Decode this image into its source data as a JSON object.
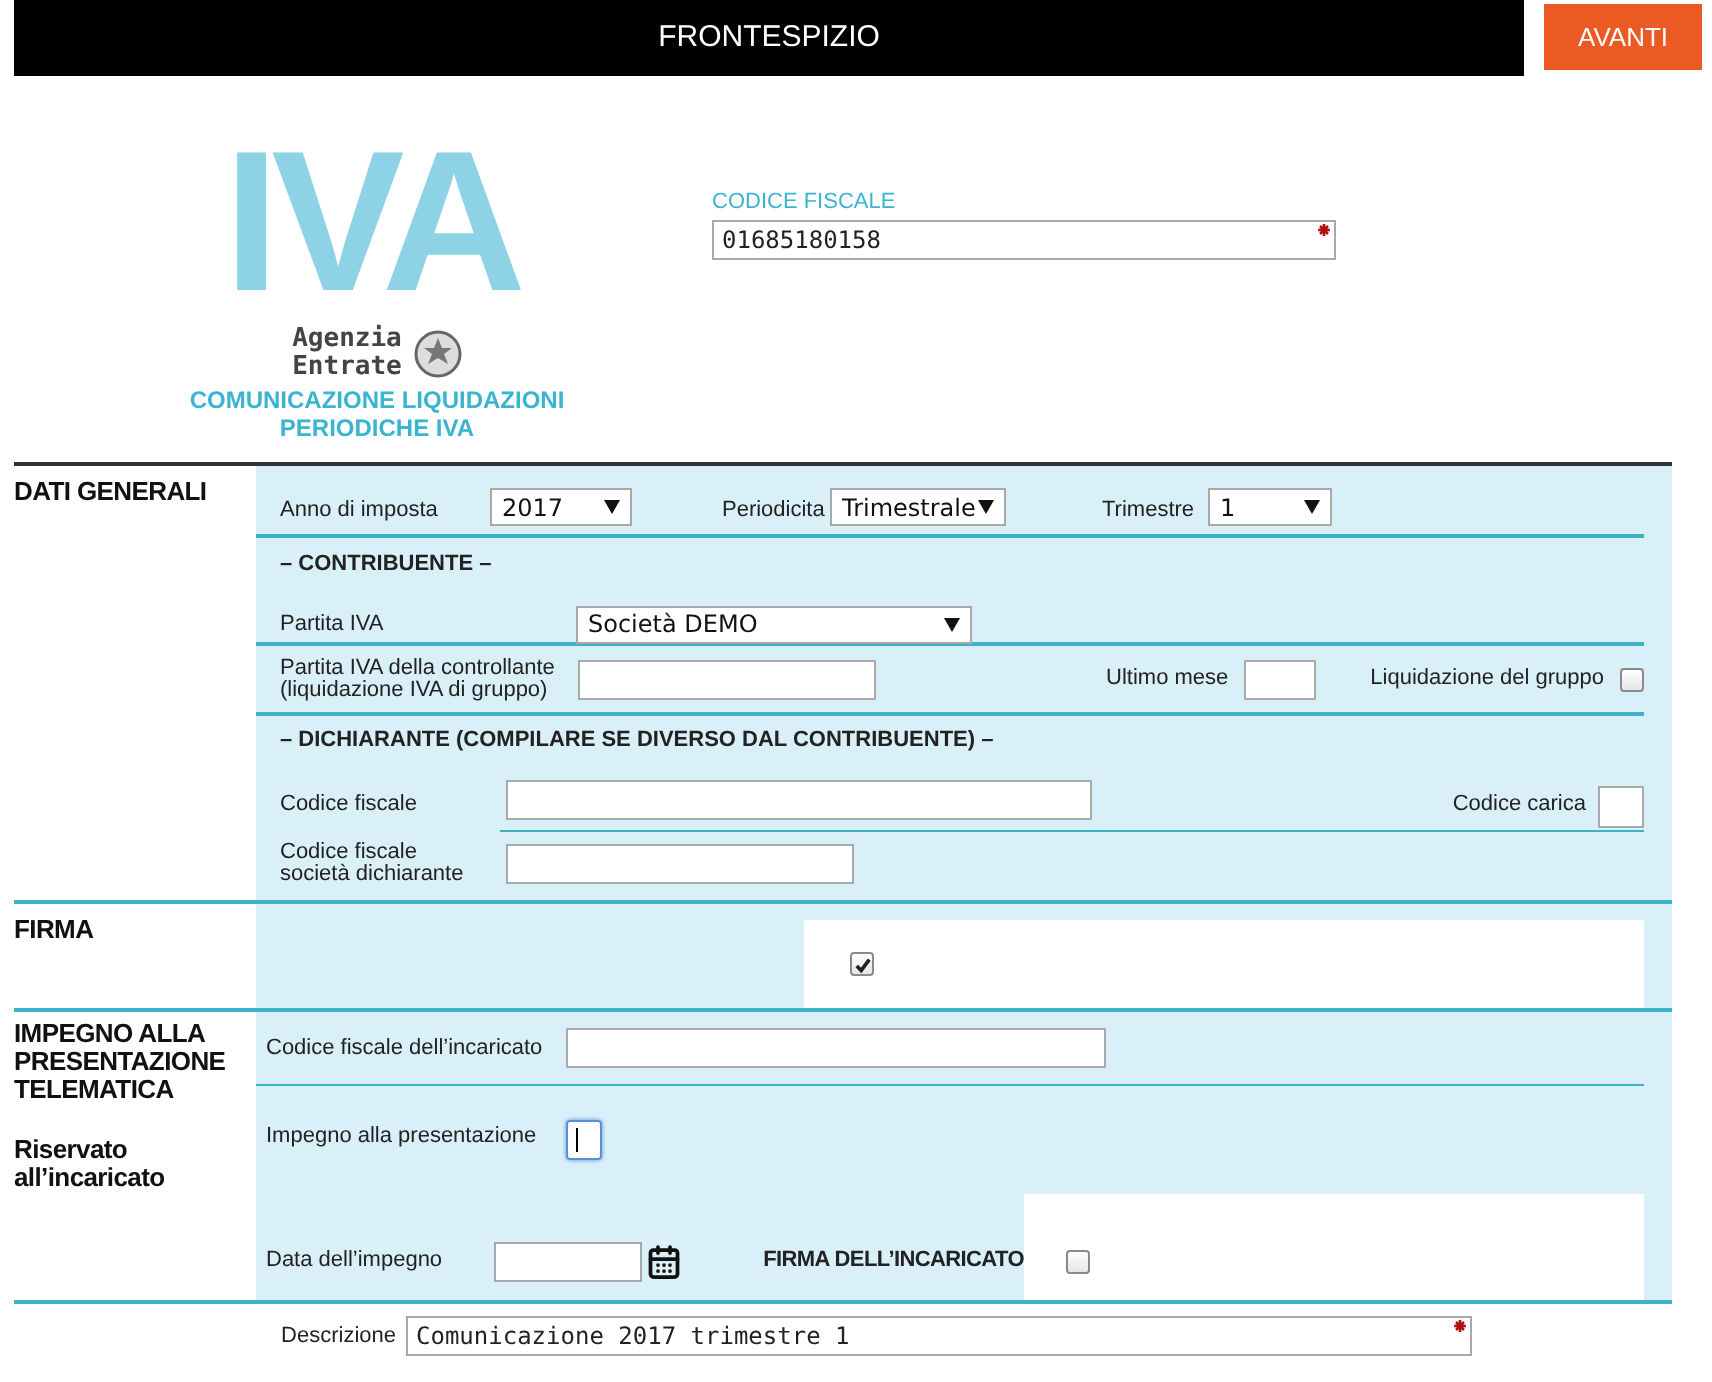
{
  "header": {
    "title": "FRONTESPIZIO",
    "next_button": "AVANTI"
  },
  "logo": {
    "mark": "IVA",
    "agency": [
      "Agenzia",
      "Entrate"
    ],
    "subtitle": [
      "COMUNICAZIONE LIQUIDAZIONI",
      "PERIODICHE IVA"
    ]
  },
  "codice_fiscale": {
    "label": "CODICE FISCALE",
    "value": "01685180158",
    "required": true
  },
  "dati_generali": {
    "title": "DATI GENERALI",
    "anno": {
      "label": "Anno di imposta",
      "value": "2017"
    },
    "periodicita": {
      "label": "Periodicita",
      "value": "Trimestrale"
    },
    "trimestre": {
      "label": "Trimestre",
      "value": "1"
    },
    "contribuente": {
      "heading": "– CONTRIBUENTE –",
      "partita_iva": {
        "label": "Partita IVA",
        "value": "Società DEMO"
      },
      "controllante": {
        "label": "Partita IVA della controllante",
        "sublabel": "(liquidazione IVA di gruppo)"
      },
      "ultimo_mese": {
        "label": "Ultimo mese"
      },
      "liquidazione_gruppo": {
        "label": "Liquidazione del gruppo",
        "checked": false
      }
    },
    "dichiarante": {
      "heading": "– DICHIARANTE (COMPILARE SE DIVERSO DAL CONTRIBUENTE) –",
      "codice_fiscale": {
        "label": "Codice fiscale"
      },
      "codice_carica": {
        "label": "Codice carica"
      },
      "codice_fiscale_societa": {
        "label": "Codice fiscale società dichiarante"
      }
    }
  },
  "firma": {
    "title": "FIRMA",
    "checked": true
  },
  "impegno": {
    "title": "IMPEGNO ALLA PRESENTAZIONE TELEMATICA",
    "subtitle": "Riservato all’incaricato",
    "codice_fiscale_incaricato": {
      "label": "Codice fiscale dell’incaricato"
    },
    "impegno_presentazione": {
      "label": "Impegno alla presentazione",
      "focused": true
    },
    "data_impegno": {
      "label": "Data dell’impegno"
    },
    "firma_incaricato": {
      "label": "FIRMA DELL’INCARICATO",
      "checked": false
    }
  },
  "descrizione": {
    "label": "Descrizione",
    "value": "Comunicazione 2017 trimestre 1",
    "required": true
  }
}
